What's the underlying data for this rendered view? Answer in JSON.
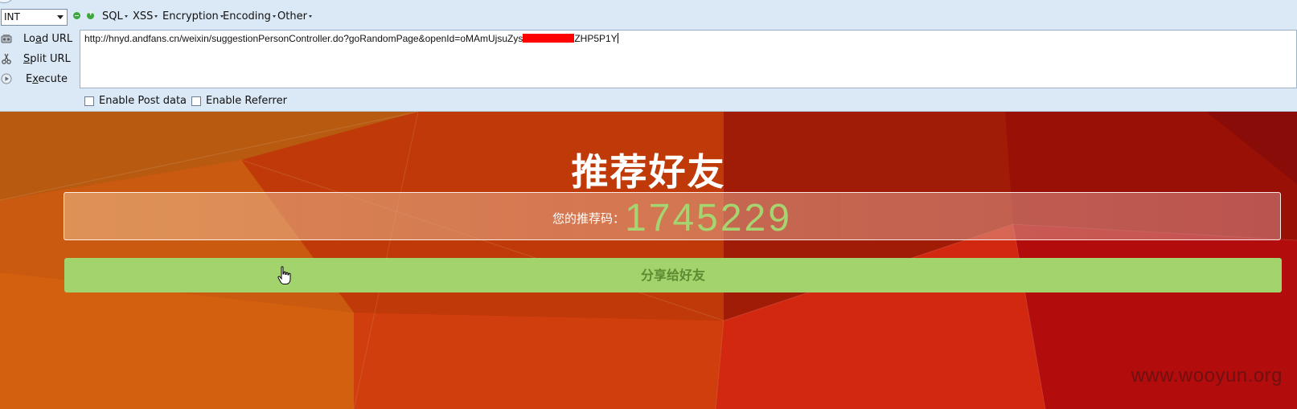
{
  "hackbar": {
    "select_value": "INT",
    "menus": [
      "SQL",
      "XSS",
      "Encryption",
      "Encoding",
      "Other"
    ],
    "actions": {
      "load_url": {
        "pre": "Lo",
        "accel": "a",
        "post": "d URL"
      },
      "split_url": {
        "pre": "",
        "accel": "S",
        "post": "plit URL"
      },
      "execute": {
        "pre": "E",
        "accel": "x",
        "post": "ecute"
      }
    },
    "url": {
      "prefix": "http://hnyd.andfans.cn/weixin/suggestionPersonController.do?goRandomPage&openId=oMAmUjsuZys",
      "suffix": "ZHP5P1Y"
    },
    "enable_post_data": "Enable Post data",
    "enable_referrer": "Enable Referrer"
  },
  "page": {
    "title": "推荐好友",
    "code_label": "您的推荐码：",
    "code_value": "1745229",
    "share_button": "分享给好友",
    "watermark": "www.wooyun.org"
  },
  "colors": {
    "code_value": "#a6d470",
    "share_button_bg": "#a2d36c",
    "share_button_text": "#5f8a33"
  }
}
